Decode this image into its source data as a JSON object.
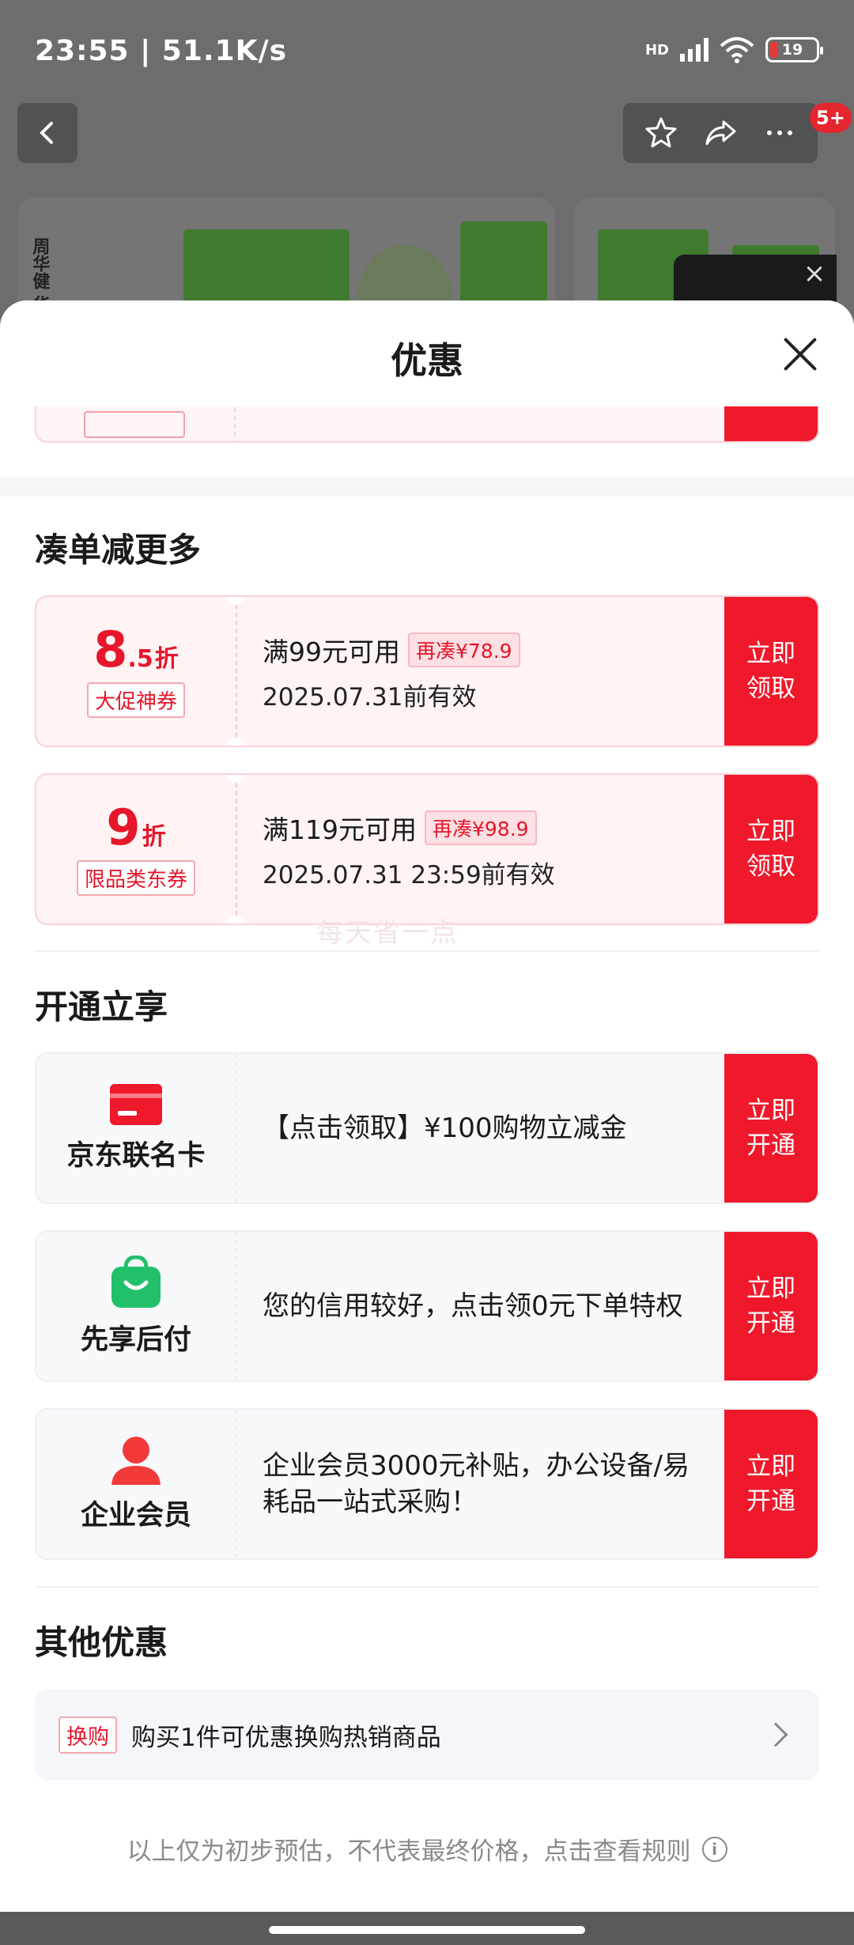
{
  "status_bar": {
    "time": "23:55 | 51.1K/s",
    "network": "HD",
    "battery": "19"
  },
  "product_page": {
    "badge": "5+",
    "vertical_text": "周华健 华美品牌"
  },
  "sheet": {
    "title": "优惠"
  },
  "sections": {
    "bundle": {
      "title": "凑单减更多",
      "coupons": [
        {
          "discount_int": "8",
          "discount_dec": ".5",
          "unit": "折",
          "tag": "大促神券",
          "condition": "满99元可用",
          "extra": "再凑¥78.9",
          "expire": "2025.07.31前有效",
          "action": "立即领取"
        },
        {
          "discount_int": "9",
          "discount_dec": "",
          "unit": "折",
          "tag": "限品类东券",
          "condition": "满119元可用",
          "extra": "再凑¥98.9",
          "expire": "2025.07.31 23:59前有效",
          "action": "立即领取"
        }
      ]
    },
    "open": {
      "title": "开通立享",
      "items": [
        {
          "name": "京东联名卡",
          "desc": "【点击领取】¥100购物立减金",
          "action": "立即开通"
        },
        {
          "name": "先享后付",
          "desc": "您的信用较好，点击领0元下单特权",
          "action": "立即开通"
        },
        {
          "name": "企业会员",
          "desc": " 企业会员3000元补贴，办公设备/易耗品一站式采购！",
          "action": "立即开通"
        }
      ]
    },
    "other": {
      "title": "其他优惠",
      "tag": "换购",
      "text": "购买1件可优惠换购热销商品"
    }
  },
  "watermark": "每天省一点",
  "footnote": "以上仅为初步预估，不代表最终价格，点击查看规则",
  "colors": {
    "accent": "#f0182b",
    "coupon_bg": "#fff3f4",
    "section_gray": "#f5f6f8"
  }
}
